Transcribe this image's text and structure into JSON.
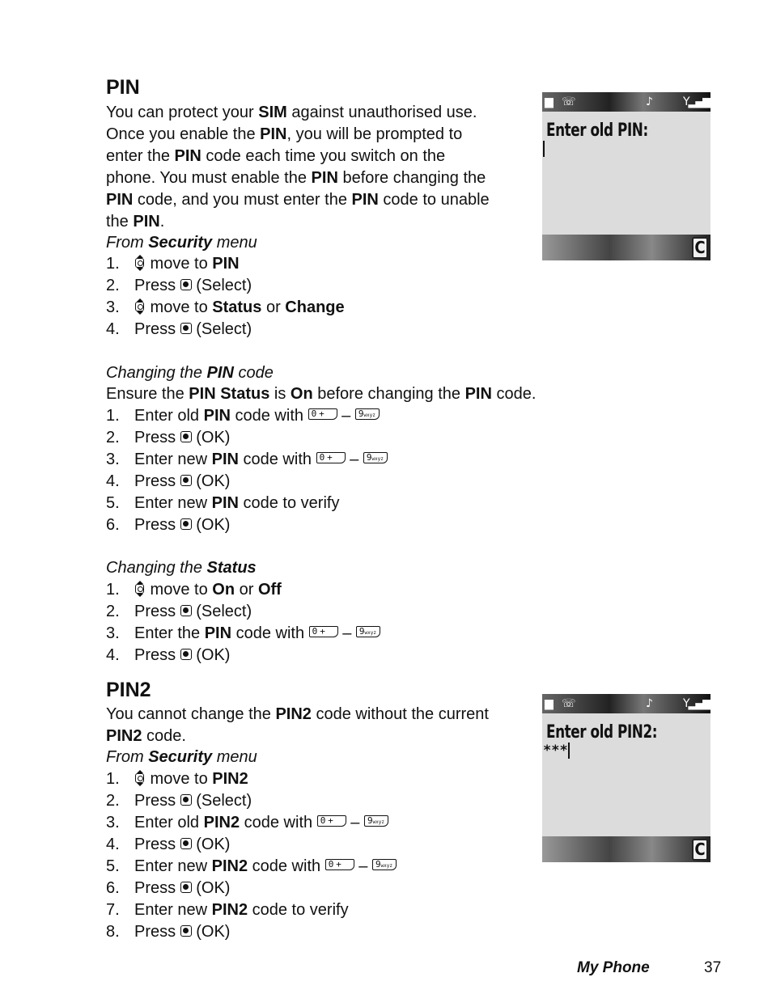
{
  "pin_section": {
    "heading": "PIN",
    "intro_lines": [
      [
        {
          "t": "You can protect your "
        },
        {
          "t": "SIM",
          "b": 1
        },
        {
          "t": " against unauthorised use."
        }
      ],
      [
        {
          "t": "Once you enable the "
        },
        {
          "t": "PIN",
          "b": 1
        },
        {
          "t": ", you will be prompted to"
        }
      ],
      [
        {
          "t": "enter the "
        },
        {
          "t": "PIN",
          "b": 1
        },
        {
          "t": " code each time you switch on the"
        }
      ],
      [
        {
          "t": "phone. You must enable the "
        },
        {
          "t": "PIN",
          "b": 1
        },
        {
          "t": " before changing the"
        }
      ],
      [
        {
          "t": "PIN",
          "b": 1
        },
        {
          "t": " code, and you must enter the "
        },
        {
          "t": "PIN",
          "b": 1
        },
        {
          "t": " code to unable"
        }
      ],
      [
        {
          "t": "the "
        },
        {
          "t": "PIN",
          "b": 1
        },
        {
          "t": "."
        }
      ]
    ],
    "from_menu": [
      {
        "t": "From "
      },
      {
        "t": "Security",
        "b": 1
      },
      {
        "t": " menu"
      }
    ],
    "steps": [
      {
        "n": "1.",
        "parts": [
          {
            "icon": "nav"
          },
          {
            "t": " move to "
          },
          {
            "t": "PIN",
            "b": 1
          }
        ]
      },
      {
        "n": "2.",
        "parts": [
          {
            "t": "Press "
          },
          {
            "icon": "ok"
          },
          {
            "t": " (Select)"
          }
        ]
      },
      {
        "n": "3.",
        "parts": [
          {
            "icon": "nav"
          },
          {
            "t": " move to "
          },
          {
            "t": "Status",
            "b": 1
          },
          {
            "t": " or "
          },
          {
            "t": "Change",
            "b": 1
          }
        ]
      },
      {
        "n": "4.",
        "parts": [
          {
            "t": "Press "
          },
          {
            "icon": "ok"
          },
          {
            "t": " (Select)"
          }
        ]
      }
    ],
    "changing_code": {
      "title": [
        {
          "t": "Changing the "
        },
        {
          "t": "PIN",
          "b": 1
        },
        {
          "t": " code"
        }
      ],
      "note": [
        {
          "t": "Ensure the "
        },
        {
          "t": "PIN Status",
          "b": 1
        },
        {
          "t": " is "
        },
        {
          "t": "On",
          "b": 1
        },
        {
          "t": " before changing the "
        },
        {
          "t": "PIN",
          "b": 1
        },
        {
          "t": " code."
        }
      ],
      "steps": [
        {
          "n": "1.",
          "parts": [
            {
              "t": "Enter old "
            },
            {
              "t": "PIN",
              "b": 1
            },
            {
              "t": " code with "
            },
            {
              "icon": "key0"
            },
            {
              "t": " – "
            },
            {
              "icon": "key9"
            }
          ]
        },
        {
          "n": "2.",
          "parts": [
            {
              "t": "Press "
            },
            {
              "icon": "ok"
            },
            {
              "t": " (OK)"
            }
          ]
        },
        {
          "n": "3.",
          "parts": [
            {
              "t": "Enter new "
            },
            {
              "t": "PIN",
              "b": 1
            },
            {
              "t": " code with "
            },
            {
              "icon": "key0"
            },
            {
              "t": " – "
            },
            {
              "icon": "key9"
            }
          ]
        },
        {
          "n": "4.",
          "parts": [
            {
              "t": "Press "
            },
            {
              "icon": "ok"
            },
            {
              "t": " (OK)"
            }
          ]
        },
        {
          "n": "5.",
          "parts": [
            {
              "t": "Enter new "
            },
            {
              "t": "PIN",
              "b": 1
            },
            {
              "t": " code to verify"
            }
          ]
        },
        {
          "n": "6.",
          "parts": [
            {
              "t": "Press "
            },
            {
              "icon": "ok"
            },
            {
              "t": " (OK)"
            }
          ]
        }
      ]
    },
    "changing_status": {
      "title": [
        {
          "t": "Changing the "
        },
        {
          "t": "Status",
          "b": 1
        }
      ],
      "steps": [
        {
          "n": "1.",
          "parts": [
            {
              "icon": "nav"
            },
            {
              "t": " move to "
            },
            {
              "t": "On",
              "b": 1
            },
            {
              "t": " or "
            },
            {
              "t": "Off",
              "b": 1
            }
          ]
        },
        {
          "n": "2.",
          "parts": [
            {
              "t": "Press "
            },
            {
              "icon": "ok"
            },
            {
              "t": " (Select)"
            }
          ]
        },
        {
          "n": "3.",
          "parts": [
            {
              "t": "Enter the "
            },
            {
              "t": "PIN",
              "b": 1
            },
            {
              "t": " code with "
            },
            {
              "icon": "key0"
            },
            {
              "t": " – "
            },
            {
              "icon": "key9"
            }
          ]
        },
        {
          "n": "4.",
          "parts": [
            {
              "t": "Press "
            },
            {
              "icon": "ok"
            },
            {
              "t": " (OK)"
            }
          ]
        }
      ]
    },
    "screen": {
      "prompt": "Enter old PIN:",
      "entry": ""
    }
  },
  "pin2_section": {
    "heading": "PIN2",
    "intro_lines": [
      [
        {
          "t": "You cannot change the "
        },
        {
          "t": "PIN2",
          "b": 1
        },
        {
          "t": " code without the current"
        }
      ],
      [
        {
          "t": "PIN2",
          "b": 1
        },
        {
          "t": " code."
        }
      ]
    ],
    "from_menu": [
      {
        "t": "From "
      },
      {
        "t": "Security",
        "b": 1
      },
      {
        "t": " menu"
      }
    ],
    "steps": [
      {
        "n": "1.",
        "parts": [
          {
            "icon": "nav"
          },
          {
            "t": " move to "
          },
          {
            "t": "PIN2",
            "b": 1
          }
        ]
      },
      {
        "n": "2.",
        "parts": [
          {
            "t": "Press "
          },
          {
            "icon": "ok"
          },
          {
            "t": " (Select)"
          }
        ]
      },
      {
        "n": "3.",
        "parts": [
          {
            "t": "Enter old "
          },
          {
            "t": "PIN2",
            "b": 1
          },
          {
            "t": " code with "
          },
          {
            "icon": "key0"
          },
          {
            "t": " – "
          },
          {
            "icon": "key9"
          }
        ]
      },
      {
        "n": "4.",
        "parts": [
          {
            "t": "Press "
          },
          {
            "icon": "ok"
          },
          {
            "t": " (OK)"
          }
        ]
      },
      {
        "n": "5.",
        "parts": [
          {
            "t": "Enter new "
          },
          {
            "t": "PIN2",
            "b": 1
          },
          {
            "t": " code with "
          },
          {
            "icon": "key0"
          },
          {
            "t": " – "
          },
          {
            "icon": "key9"
          }
        ]
      },
      {
        "n": "6.",
        "parts": [
          {
            "t": "Press "
          },
          {
            "icon": "ok"
          },
          {
            "t": " (OK)"
          }
        ]
      },
      {
        "n": "7.",
        "parts": [
          {
            "t": "Enter new "
          },
          {
            "t": "PIN2",
            "b": 1
          },
          {
            "t": " code to verify"
          }
        ]
      },
      {
        "n": "8.",
        "parts": [
          {
            "t": "Press "
          },
          {
            "icon": "ok"
          },
          {
            "t": " (OK)"
          }
        ]
      }
    ],
    "screen": {
      "prompt": "Enter old PIN2:",
      "entry": "***"
    }
  },
  "icons": {
    "key0_label": "0+",
    "key9_label": "9",
    "key9_sub": "wxyz",
    "soft_key": "C",
    "status_left": "▢",
    "status_music": "♪",
    "status_signal": "Y"
  },
  "footer": {
    "title": "My Phone",
    "page": "37"
  }
}
